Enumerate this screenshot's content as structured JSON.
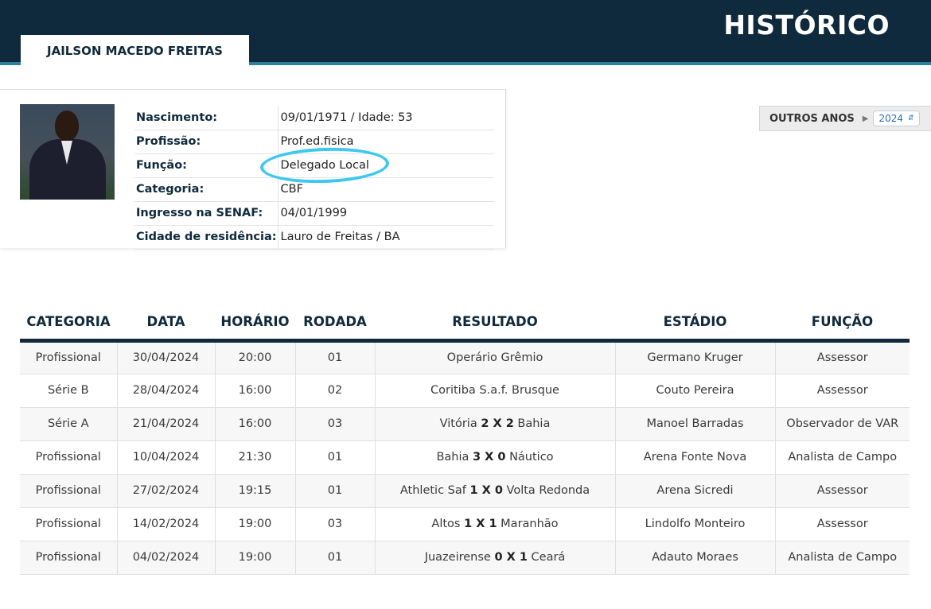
{
  "header": {
    "title": "HISTÓRICO",
    "person_name": "JAILSON MACEDO FREITAS"
  },
  "profile": {
    "fields": [
      {
        "label": "Nascimento:",
        "value": "09/01/1971 / Idade: 53"
      },
      {
        "label": "Profissão:",
        "value": "Prof.ed.fisica"
      },
      {
        "label": "Função:",
        "value": "Delegado Local"
      },
      {
        "label": "Categoria:",
        "value": "CBF"
      },
      {
        "label": "Ingresso na SENAF:",
        "value": "04/01/1999"
      },
      {
        "label": "Cidade de residência:",
        "value": "Lauro de Freitas / BA"
      }
    ],
    "highlight_color": "#3cc8f0"
  },
  "year_filter": {
    "label": "OUTROS ANOS",
    "selected": "2024",
    "arrow_icon": "play-right-icon"
  },
  "matches": {
    "headers": [
      "CATEGORIA",
      "DATA",
      "HORÁRIO",
      "RODADA",
      "RESULTADO",
      "ESTÁDIO",
      "FUNÇÃO"
    ],
    "rows": [
      {
        "categoria": "Profissional",
        "data": "30/04/2024",
        "horario": "20:00",
        "rodada": "01",
        "home": "Operário",
        "score": "",
        "away": "Grêmio",
        "estadio": "Germano Kruger",
        "funcao": "Assessor"
      },
      {
        "categoria": "Série B",
        "data": "28/04/2024",
        "horario": "16:00",
        "rodada": "02",
        "home": "Coritiba S.a.f.",
        "score": "",
        "away": "Brusque",
        "estadio": "Couto Pereira",
        "funcao": "Assessor"
      },
      {
        "categoria": "Série A",
        "data": "21/04/2024",
        "horario": "16:00",
        "rodada": "03",
        "home": "Vitória",
        "score": "2 X 2",
        "away": "Bahia",
        "estadio": "Manoel Barradas",
        "funcao": "Observador de VAR"
      },
      {
        "categoria": "Profissional",
        "data": "10/04/2024",
        "horario": "21:30",
        "rodada": "01",
        "home": "Bahia",
        "score": "3 X 0",
        "away": "Náutico",
        "estadio": "Arena Fonte Nova",
        "funcao": "Analista de Campo"
      },
      {
        "categoria": "Profissional",
        "data": "27/02/2024",
        "horario": "19:15",
        "rodada": "01",
        "home": "Athletic Saf",
        "score": "1 X 0",
        "away": "Volta Redonda",
        "estadio": "Arena Sicredi",
        "funcao": "Assessor"
      },
      {
        "categoria": "Profissional",
        "data": "14/02/2024",
        "horario": "19:00",
        "rodada": "03",
        "home": "Altos",
        "score": "1 X 1",
        "away": "Maranhão",
        "estadio": "Lindolfo Monteiro",
        "funcao": "Assessor"
      },
      {
        "categoria": "Profissional",
        "data": "04/02/2024",
        "horario": "19:00",
        "rodada": "01",
        "home": "Juazeirense",
        "score": "0 X 1",
        "away": "Ceará",
        "estadio": "Adauto Moraes",
        "funcao": "Analista de Campo"
      }
    ]
  }
}
